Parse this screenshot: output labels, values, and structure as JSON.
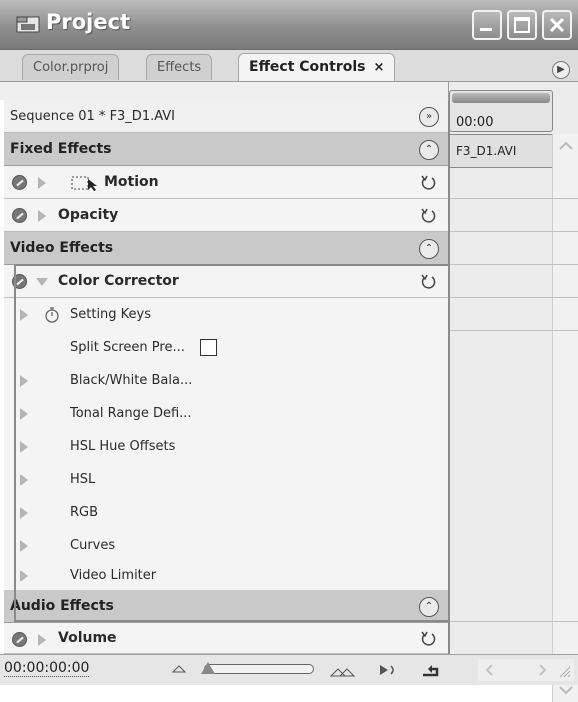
{
  "window": {
    "title": "Project"
  },
  "tabs": [
    {
      "label": "Color.prproj",
      "active": false
    },
    {
      "label": "Effects",
      "active": false
    },
    {
      "label": "Effect Controls",
      "active": true,
      "close": "×"
    }
  ],
  "sequence": {
    "label": "Sequence 01 * F3_D1.AVI"
  },
  "sections": {
    "fixed": "Fixed Effects",
    "video": "Video Effects",
    "audio": "Audio Effects"
  },
  "effects": {
    "motion": "Motion",
    "opacity": "Opacity",
    "color_corrector": "Color Corrector",
    "volume": "Volume"
  },
  "color_corrector_params": [
    {
      "label": "Setting Keys"
    },
    {
      "label": "Split Screen Pre..."
    },
    {
      "label": "Black/White Bala..."
    },
    {
      "label": "Tonal Range Defi..."
    },
    {
      "label": "HSL Hue Offsets"
    },
    {
      "label": "HSL"
    },
    {
      "label": "RGB"
    },
    {
      "label": "Curves"
    },
    {
      "label": "Video Limiter"
    }
  ],
  "timeline": {
    "time_label": "00:00",
    "clip_name": "F3_D1.AVI"
  },
  "footer": {
    "timecode": "00:00:00:00",
    "zoom_level": 0.0
  },
  "icons": {
    "fx_toggle": "fx-toggle-icon",
    "reset": "reset-icon",
    "collapse": "collapse-icon",
    "expand_timeline": "expand-timeline-icon"
  },
  "colors": {
    "title_bar": "#8f8f8f",
    "section_header": "#c9c9c9",
    "row_bg": "#f4f4f4"
  }
}
